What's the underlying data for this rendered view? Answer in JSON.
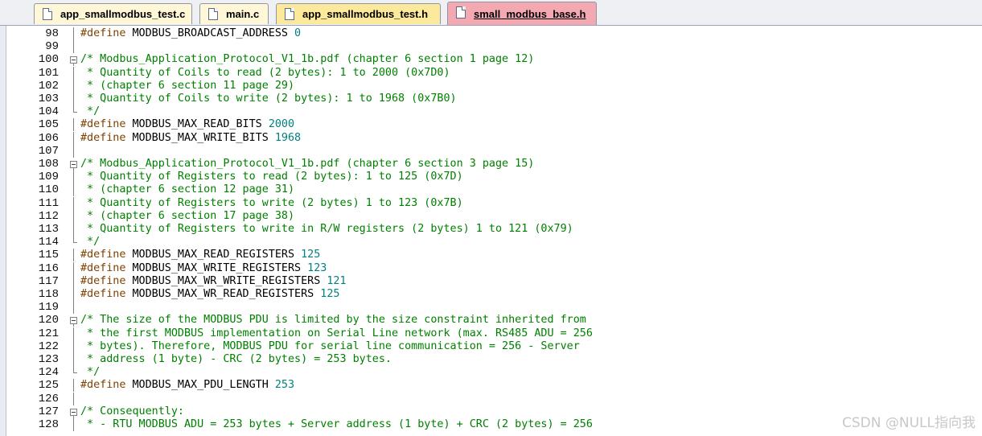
{
  "tabs": [
    {
      "label": "app_smallmodbus_test.c",
      "type": "c"
    },
    {
      "label": "main.c",
      "type": "c"
    },
    {
      "label": "app_smallmodbus_test.h",
      "type": "h"
    },
    {
      "label": "small_modbus_base.h",
      "type": "h",
      "active": true
    }
  ],
  "editor": {
    "lines": [
      {
        "num": "98",
        "fold": "bar",
        "code": "#define MODBUS_BROADCAST_ADDRESS 0"
      },
      {
        "num": "99",
        "fold": "bar",
        "code": ""
      },
      {
        "num": "100",
        "fold": "box",
        "code": "/* Modbus_Application_Protocol_V1_1b.pdf (chapter 6 section 1 page 12)"
      },
      {
        "num": "101",
        "fold": "bar",
        "code": " * Quantity of Coils to read (2 bytes): 1 to 2000 (0x7D0)"
      },
      {
        "num": "102",
        "fold": "bar",
        "code": " * (chapter 6 section 11 page 29)"
      },
      {
        "num": "103",
        "fold": "bar",
        "code": " * Quantity of Coils to write (2 bytes): 1 to 1968 (0x7B0)"
      },
      {
        "num": "104",
        "fold": "end",
        "code": " */"
      },
      {
        "num": "105",
        "fold": "bar",
        "code": "#define MODBUS_MAX_READ_BITS 2000"
      },
      {
        "num": "106",
        "fold": "bar",
        "code": "#define MODBUS_MAX_WRITE_BITS 1968"
      },
      {
        "num": "107",
        "fold": "bar",
        "code": ""
      },
      {
        "num": "108",
        "fold": "box",
        "code": "/* Modbus_Application_Protocol_V1_1b.pdf (chapter 6 section 3 page 15)"
      },
      {
        "num": "109",
        "fold": "bar",
        "code": " * Quantity of Registers to read (2 bytes): 1 to 125 (0x7D)"
      },
      {
        "num": "110",
        "fold": "bar",
        "code": " * (chapter 6 section 12 page 31)"
      },
      {
        "num": "111",
        "fold": "bar",
        "code": " * Quantity of Registers to write (2 bytes) 1 to 123 (0x7B)"
      },
      {
        "num": "112",
        "fold": "bar",
        "code": " * (chapter 6 section 17 page 38)"
      },
      {
        "num": "113",
        "fold": "bar",
        "code": " * Quantity of Registers to write in R/W registers (2 bytes) 1 to 121 (0x79)"
      },
      {
        "num": "114",
        "fold": "end",
        "code": " */"
      },
      {
        "num": "115",
        "fold": "bar",
        "code": "#define MODBUS_MAX_READ_REGISTERS 125"
      },
      {
        "num": "116",
        "fold": "bar",
        "code": "#define MODBUS_MAX_WRITE_REGISTERS 123"
      },
      {
        "num": "117",
        "fold": "bar",
        "code": "#define MODBUS_MAX_WR_WRITE_REGISTERS 121"
      },
      {
        "num": "118",
        "fold": "bar",
        "code": "#define MODBUS_MAX_WR_READ_REGISTERS 125"
      },
      {
        "num": "119",
        "fold": "bar",
        "code": ""
      },
      {
        "num": "120",
        "fold": "box",
        "code": "/* The size of the MODBUS PDU is limited by the size constraint inherited from"
      },
      {
        "num": "121",
        "fold": "bar",
        "code": " * the first MODBUS implementation on Serial Line network (max. RS485 ADU = 256"
      },
      {
        "num": "122",
        "fold": "bar",
        "code": " * bytes). Therefore, MODBUS PDU for serial line communication = 256 - Server"
      },
      {
        "num": "123",
        "fold": "bar",
        "code": " * address (1 byte) - CRC (2 bytes) = 253 bytes."
      },
      {
        "num": "124",
        "fold": "end",
        "code": " */"
      },
      {
        "num": "125",
        "fold": "bar",
        "code": "#define MODBUS_MAX_PDU_LENGTH 253"
      },
      {
        "num": "126",
        "fold": "bar",
        "code": ""
      },
      {
        "num": "127",
        "fold": "box",
        "code": "/* Consequently:"
      },
      {
        "num": "128",
        "fold": "bar",
        "code": " * - RTU MODBUS ADU = 253 bytes + Server address (1 byte) + CRC (2 bytes) = 256"
      }
    ]
  },
  "watermark": "CSDN @NULL指向我",
  "colors": {
    "comment": "#008000",
    "preprocessor": "#804000",
    "number": "#008080",
    "active_tab": "#f4a9b2",
    "header_tab": "#fde99b",
    "source_tab": "#fff7d6"
  }
}
